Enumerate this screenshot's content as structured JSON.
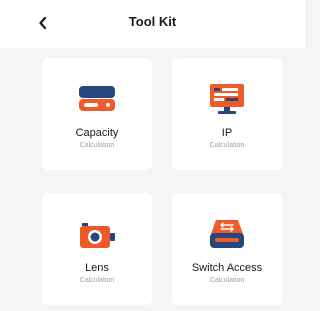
{
  "header": {
    "title": "Tool Kit",
    "back_icon": "chevron-left-icon"
  },
  "colors": {
    "accent_orange": "#ee5a28",
    "accent_blue": "#26467e",
    "background": "#f5f5f7",
    "card": "#ffffff"
  },
  "tools": [
    {
      "label": "Capacity",
      "sub": "Calculation",
      "icon": "hard-drive-icon"
    },
    {
      "label": "IP",
      "sub": "Calculation",
      "icon": "monitor-icon"
    },
    {
      "label": "Lens",
      "sub": "Calculation",
      "icon": "camera-icon"
    },
    {
      "label": "Switch Access",
      "sub": "Calculation",
      "icon": "network-switch-icon"
    }
  ]
}
